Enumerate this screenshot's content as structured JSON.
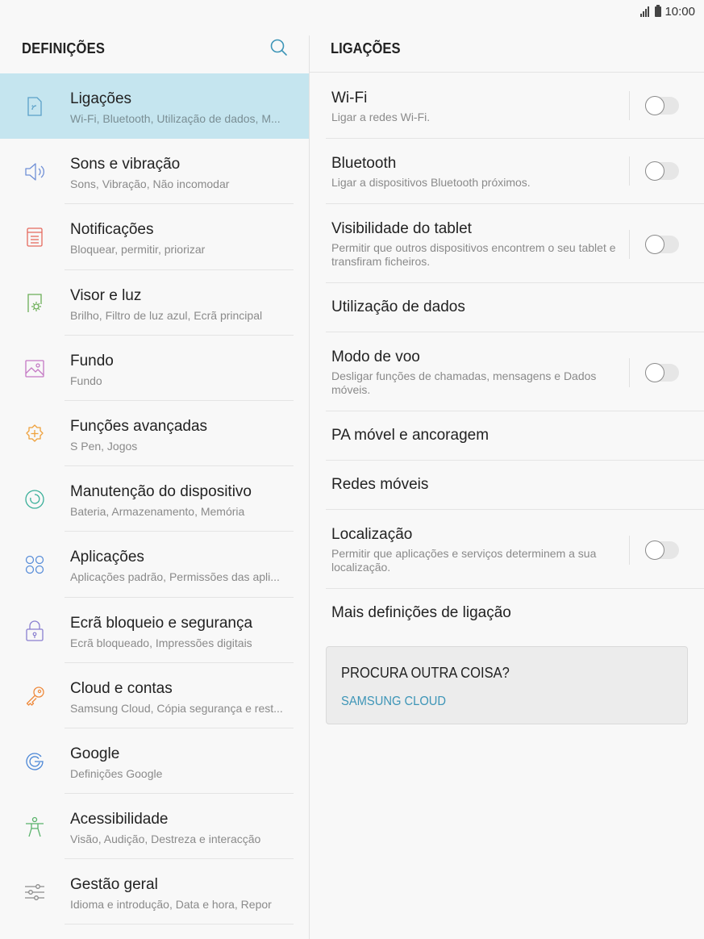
{
  "status": {
    "time": "10:00"
  },
  "left": {
    "title": "DEFINIÇÕES",
    "items": [
      {
        "title": "Ligações",
        "sub": "Wi-Fi, Bluetooth, Utilização de dados, M...",
        "icon": "connections-icon",
        "active": true
      },
      {
        "title": "Sons e vibração",
        "sub": "Sons, Vibração, Não incomodar",
        "icon": "speaker-icon"
      },
      {
        "title": "Notificações",
        "sub": "Bloquear, permitir, priorizar",
        "icon": "notifications-icon"
      },
      {
        "title": "Visor e luz",
        "sub": "Brilho, Filtro de luz azul, Ecrã principal",
        "icon": "display-icon"
      },
      {
        "title": "Fundo",
        "sub": "Fundo",
        "icon": "wallpaper-icon"
      },
      {
        "title": "Funções avançadas",
        "sub": "S Pen, Jogos",
        "icon": "advanced-features-icon"
      },
      {
        "title": "Manutenção do dispositivo",
        "sub": "Bateria, Armazenamento, Memória",
        "icon": "device-maintenance-icon"
      },
      {
        "title": "Aplicações",
        "sub": "Aplicações padrão, Permissões das apli...",
        "icon": "apps-icon"
      },
      {
        "title": "Ecrã bloqueio e segurança",
        "sub": "Ecrã bloqueado, Impressões digitais",
        "icon": "lock-icon"
      },
      {
        "title": "Cloud e contas",
        "sub": "Samsung Cloud, Cópia segurança e rest...",
        "icon": "key-icon"
      },
      {
        "title": "Google",
        "sub": "Definições Google",
        "icon": "google-icon"
      },
      {
        "title": "Acessibilidade",
        "sub": "Visão, Audição, Destreza e interacção",
        "icon": "accessibility-icon"
      },
      {
        "title": "Gestão geral",
        "sub": "Idioma e introdução, Data e hora, Repor",
        "icon": "sliders-icon"
      }
    ]
  },
  "right": {
    "title": "LIGAÇÕES",
    "items": [
      {
        "title": "Wi-Fi",
        "sub": "Ligar a redes Wi-Fi.",
        "toggle": true,
        "on": false
      },
      {
        "title": "Bluetooth",
        "sub": "Ligar a dispositivos Bluetooth próximos.",
        "toggle": true,
        "on": false
      },
      {
        "title": "Visibilidade do tablet",
        "sub": "Permitir que outros dispositivos encontrem o seu tablet e transfiram ficheiros.",
        "toggle": true,
        "on": false
      },
      {
        "title": "Utilização de dados"
      },
      {
        "title": "Modo de voo",
        "sub": "Desligar funções de chamadas, mensagens e Dados móveis.",
        "toggle": true,
        "on": false
      },
      {
        "title": "PA móvel e ancoragem"
      },
      {
        "title": "Redes móveis"
      },
      {
        "title": "Localização",
        "sub": "Permitir que aplicações e serviços determinem a sua localização.",
        "toggle": true,
        "on": false
      },
      {
        "title": "Mais definições de ligação"
      }
    ],
    "card": {
      "title": "PROCURA OUTRA COISA?",
      "link": "SAMSUNG CLOUD"
    }
  }
}
